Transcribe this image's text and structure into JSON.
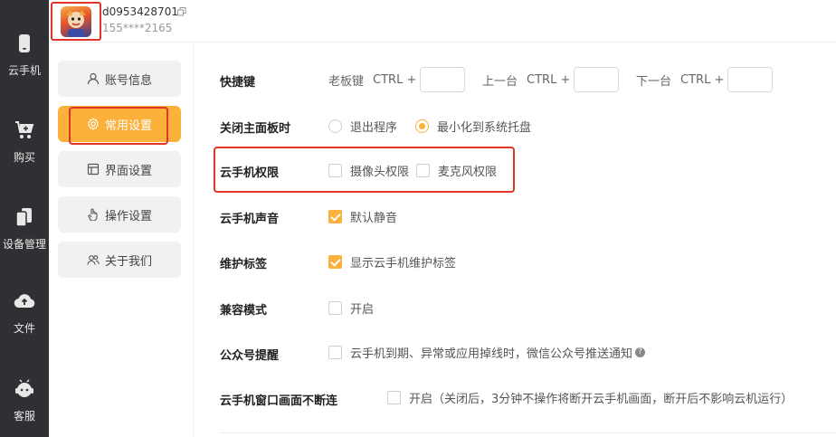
{
  "rail": {
    "items": [
      {
        "label": "云手机",
        "icon": "phone-icon"
      },
      {
        "label": "购买",
        "icon": "cart-icon"
      },
      {
        "label": "设备管理",
        "icon": "devices-icon"
      },
      {
        "label": "文件",
        "icon": "cloud-upload-icon"
      },
      {
        "label": "客服",
        "icon": "support-icon"
      }
    ]
  },
  "header": {
    "user_id": "d0953428701",
    "phone": "155****2165"
  },
  "nav": {
    "items": [
      {
        "label": "账号信息",
        "icon": "user-icon"
      },
      {
        "label": "常用设置",
        "icon": "gear-icon"
      },
      {
        "label": "界面设置",
        "icon": "layout-icon"
      },
      {
        "label": "操作设置",
        "icon": "hand-icon"
      },
      {
        "label": "关于我们",
        "icon": "people-icon"
      }
    ],
    "active_index": 1
  },
  "settings": {
    "hotkeys": {
      "label": "快捷键",
      "groups": [
        {
          "name": "老板键",
          "prefix": "CTRL +",
          "value": ""
        },
        {
          "name": "上一台",
          "prefix": "CTRL +",
          "value": ""
        },
        {
          "name": "下一台",
          "prefix": "CTRL +",
          "value": ""
        }
      ]
    },
    "close_panel": {
      "label": "关闭主面板时",
      "options": [
        {
          "label": "退出程序",
          "selected": false
        },
        {
          "label": "最小化到系统托盘",
          "selected": true
        }
      ]
    },
    "permissions": {
      "label": "云手机权限",
      "options": [
        {
          "label": "摄像头权限",
          "checked": false
        },
        {
          "label": "麦克风权限",
          "checked": false
        }
      ]
    },
    "sound": {
      "label": "云手机声音",
      "option": "默认静音",
      "checked": true
    },
    "maintenance": {
      "label": "维护标签",
      "option": "显示云手机维护标签",
      "checked": true
    },
    "compat": {
      "label": "兼容模式",
      "option": "开启",
      "checked": false
    },
    "wechat": {
      "label": "公众号提醒",
      "option": "云手机到期、异常或应用掉线时，微信公众号推送通知",
      "checked": false,
      "help": "?"
    },
    "keep_alive": {
      "label": "云手机窗口画面不断连",
      "option": "开启（关闭后，3分钟不操作将断开云手机画面，断开后不影响云机运行）",
      "checked": false
    }
  },
  "colors": {
    "accent": "#fbb13c",
    "rail_bg": "#2f3033",
    "highlight": "#e0352b"
  }
}
